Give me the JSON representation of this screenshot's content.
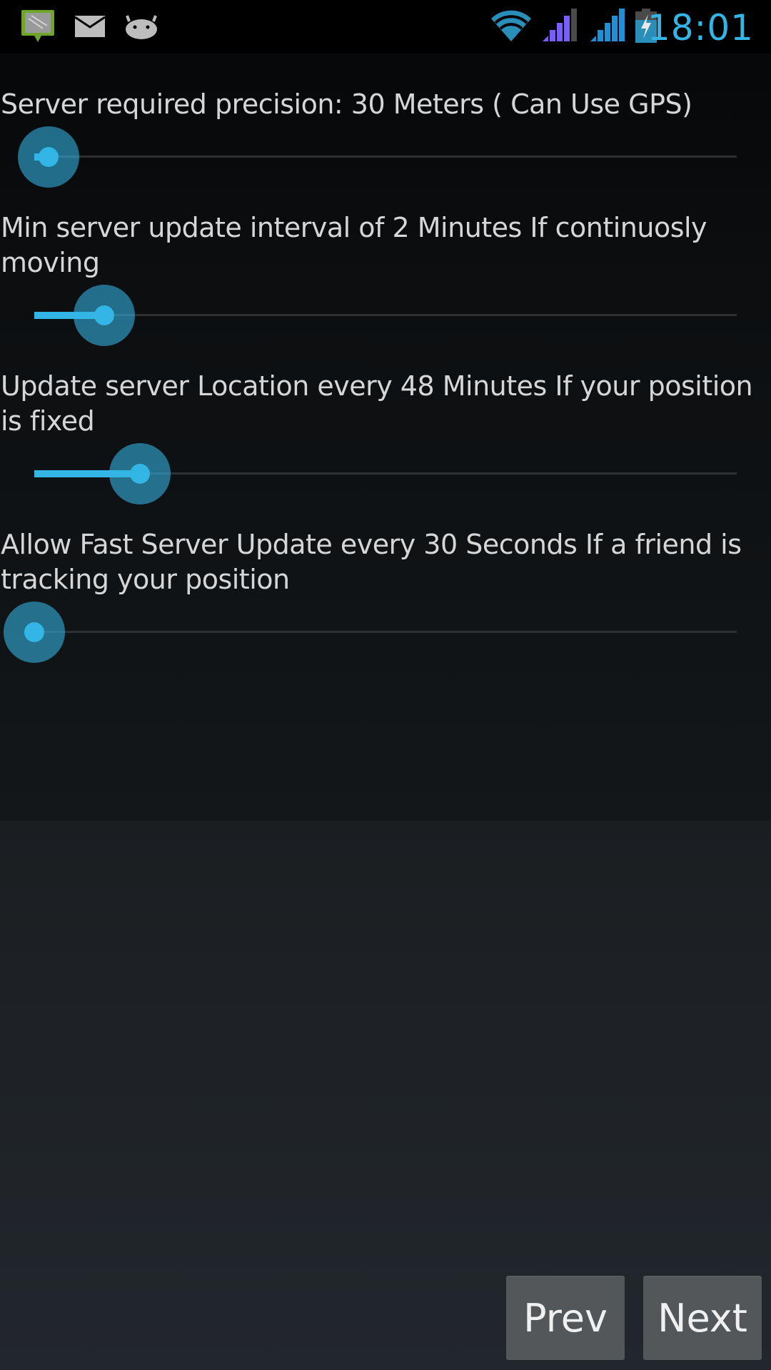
{
  "status_bar": {
    "left_icons": [
      "map-notification-icon",
      "email-icon",
      "android-icon"
    ],
    "right_icons": [
      "wifi-icon",
      "signal-icon-1",
      "signal-icon-2",
      "battery-charging-icon"
    ],
    "time": "18:01",
    "accent_color": "#33b5e5"
  },
  "settings": [
    {
      "label": "Server required precision: 30 Meters ( Can Use GPS)",
      "slider_fraction": 0.02
    },
    {
      "label": "Min server update interval of 2 Minutes If continuosly moving",
      "slider_fraction": 0.1
    },
    {
      "label": "Update server Location every 48 Minutes If your position is fixed",
      "slider_fraction": 0.15
    },
    {
      "label": "Allow Fast Server Update every 30 Seconds If a friend is tracking your position",
      "slider_fraction": 0.0
    }
  ],
  "buttons": {
    "prev": "Prev",
    "next": "Next"
  }
}
